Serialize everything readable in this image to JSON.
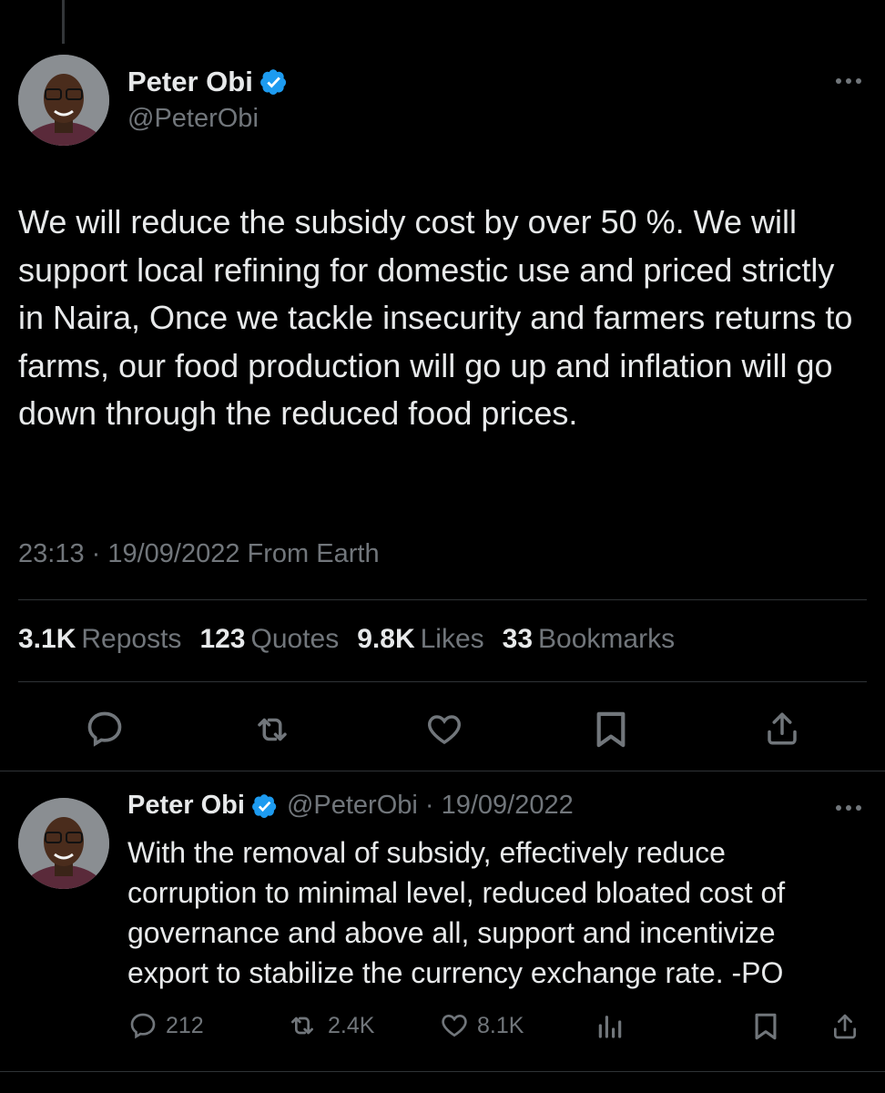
{
  "main_tweet": {
    "author_name": "Peter Obi",
    "handle": "@PeterObi",
    "text": "We will reduce the subsidy cost by over 50 %. We will support local refining for domestic use and priced strictly in Naira, Once we tackle insecurity and farmers returns to farms, our food production will go up and inflation will go down through the reduced food prices.",
    "timestamp": "23:13 · 19/09/2022 From Earth",
    "stats": [
      {
        "value": "3.1K",
        "label": "Reposts"
      },
      {
        "value": "123",
        "label": "Quotes"
      },
      {
        "value": "9.8K",
        "label": "Likes"
      },
      {
        "value": "33",
        "label": "Bookmarks"
      }
    ],
    "actions": [
      "reply-icon",
      "repost-icon",
      "like-icon",
      "bookmark-icon",
      "share-icon"
    ]
  },
  "reply_tweet": {
    "author_name": "Peter Obi",
    "meta": "@PeterObi · 19/09/2022",
    "text": "With the removal of subsidy, effectively reduce corruption to minimal level, reduced bloated cost of governance and above all, support and incentivize export to stabilize the currency exchange rate. -PO",
    "counts": {
      "replies": "212",
      "reposts": "2.4K",
      "likes": "8.1K"
    }
  },
  "colors": {
    "background": "#000000",
    "text": "#e7e9ea",
    "secondary": "#71767b",
    "divider": "#2f3336",
    "verified": "#1d9bf0"
  }
}
